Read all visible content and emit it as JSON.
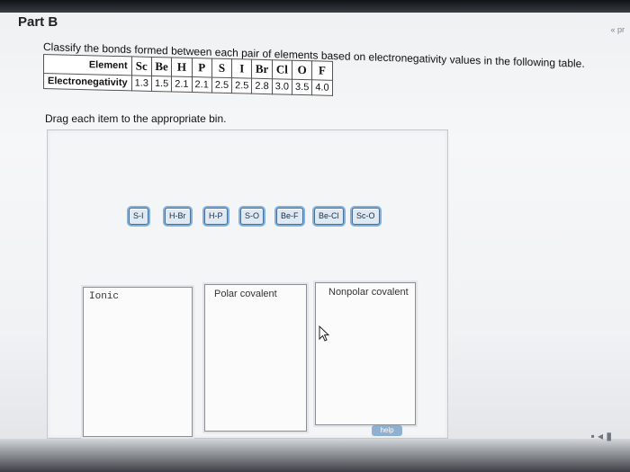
{
  "part_title": "Part B",
  "side_link": "« pr",
  "instruction": "Classify the bonds formed between each pair of elements based on electronegativity values in the following table.",
  "table": {
    "row1_header": "Element",
    "row2_header": "Electronegativity",
    "elements": [
      "Sc",
      "Be",
      "H",
      "P",
      "S",
      "I",
      "Br",
      "Cl",
      "O",
      "F"
    ],
    "values": [
      "1.3",
      "1.5",
      "2.1",
      "2.1",
      "2.5",
      "2.5",
      "2.8",
      "3.0",
      "3.5",
      "4.0"
    ]
  },
  "drag_instruction": "Drag each item to the appropriate bin.",
  "tiles": [
    "S-I",
    "H-Br",
    "H-P",
    "S-O",
    "Be-F",
    "Be-Cl",
    "Sc-O"
  ],
  "bins": {
    "ionic": "Ionic",
    "polar": "Polar covalent",
    "nonpolar": "Nonpolar covalent"
  },
  "help_label": "help"
}
